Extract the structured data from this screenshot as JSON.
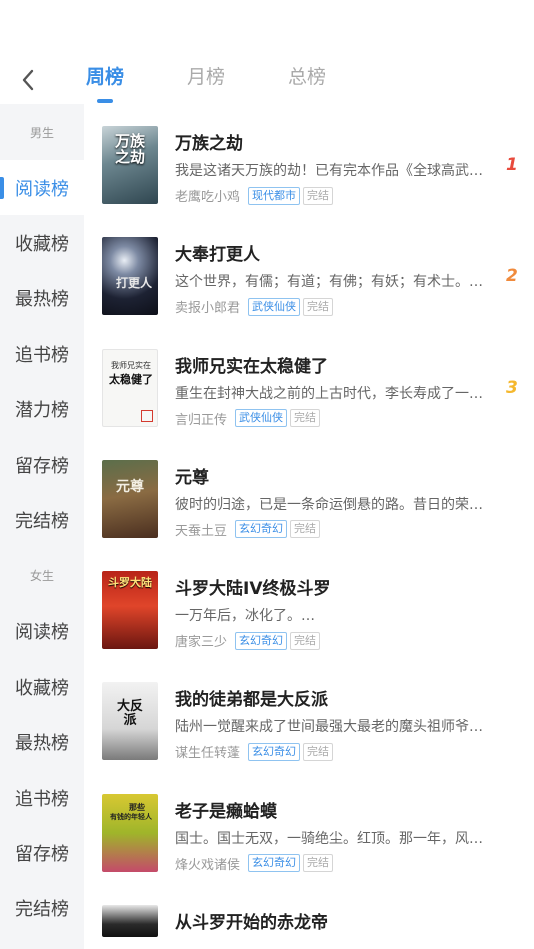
{
  "header": {
    "tabs": [
      {
        "label": "周榜"
      },
      {
        "label": "月榜"
      },
      {
        "label": "总榜"
      }
    ]
  },
  "sidebar": {
    "male_group": "男生",
    "male_items": [
      "阅读榜",
      "收藏榜",
      "最热榜",
      "追书榜",
      "潜力榜",
      "留存榜",
      "完结榜"
    ],
    "female_group": "女生",
    "female_items": [
      "阅读榜",
      "收藏榜",
      "最热榜",
      "追书榜",
      "留存榜",
      "完结榜"
    ]
  },
  "books": [
    {
      "title": "万族之劫",
      "desc": "我是这诸天万族的劫！已有完本作品《全球高武》…",
      "author": "老鹰吃小鸡",
      "genre": "现代都市",
      "status": "完结",
      "rank": "1",
      "cover_text": "万族之劫"
    },
    {
      "title": "大奉打更人",
      "desc": "这个世界，有儒；有道；有佛；有妖；有术士。…",
      "author": "卖报小郎君",
      "genre": "武侠仙侠",
      "status": "完结",
      "rank": "2",
      "cover_text": "打更人"
    },
    {
      "title": "我师兄实在太稳健了",
      "desc": "重生在封神大战之前的上古时代，李长寿成了一…",
      "author": "言归正传",
      "genre": "武侠仙侠",
      "status": "完结",
      "rank": "3",
      "cover_text": "太稳健了",
      "cover_top": "我师兄实在"
    },
    {
      "title": "元尊",
      "desc": "彼时的归途，已是一条命运倒悬的路。昔日的荣…",
      "author": "天蚕土豆",
      "genre": "玄幻奇幻",
      "status": "完结",
      "cover_text": "元尊"
    },
    {
      "title": "斗罗大陆IV终极斗罗",
      "desc": "一万年后，冰化了。…",
      "author": "唐家三少",
      "genre": "玄幻奇幻",
      "status": "完结",
      "cover_text": "斗罗大陆"
    },
    {
      "title": "我的徒弟都是大反派",
      "desc": "陆州一觉醒来成了世间最强大最老的魔头祖师爷…",
      "author": "谋生任转蓬",
      "genre": "玄幻奇幻",
      "status": "完结",
      "cover_text": "大反派"
    },
    {
      "title": "老子是癞蛤蟆",
      "desc": "国士。国士无双，一骑绝尘。红顶。那一年，风…",
      "author": "烽火戏诸侯",
      "genre": "玄幻奇幻",
      "status": "完结",
      "cover_text": "有钱的年轻人",
      "cover_top": "那些"
    },
    {
      "title": "从斗罗开始的赤龙帝",
      "desc": "",
      "author": "",
      "genre": "",
      "status": "",
      "cover_text": ""
    }
  ],
  "colors": {
    "accent": "#3a8ee6",
    "rank1": "#e84a3c",
    "rank2": "#f08a3c",
    "rank3": "#f5b82e"
  }
}
